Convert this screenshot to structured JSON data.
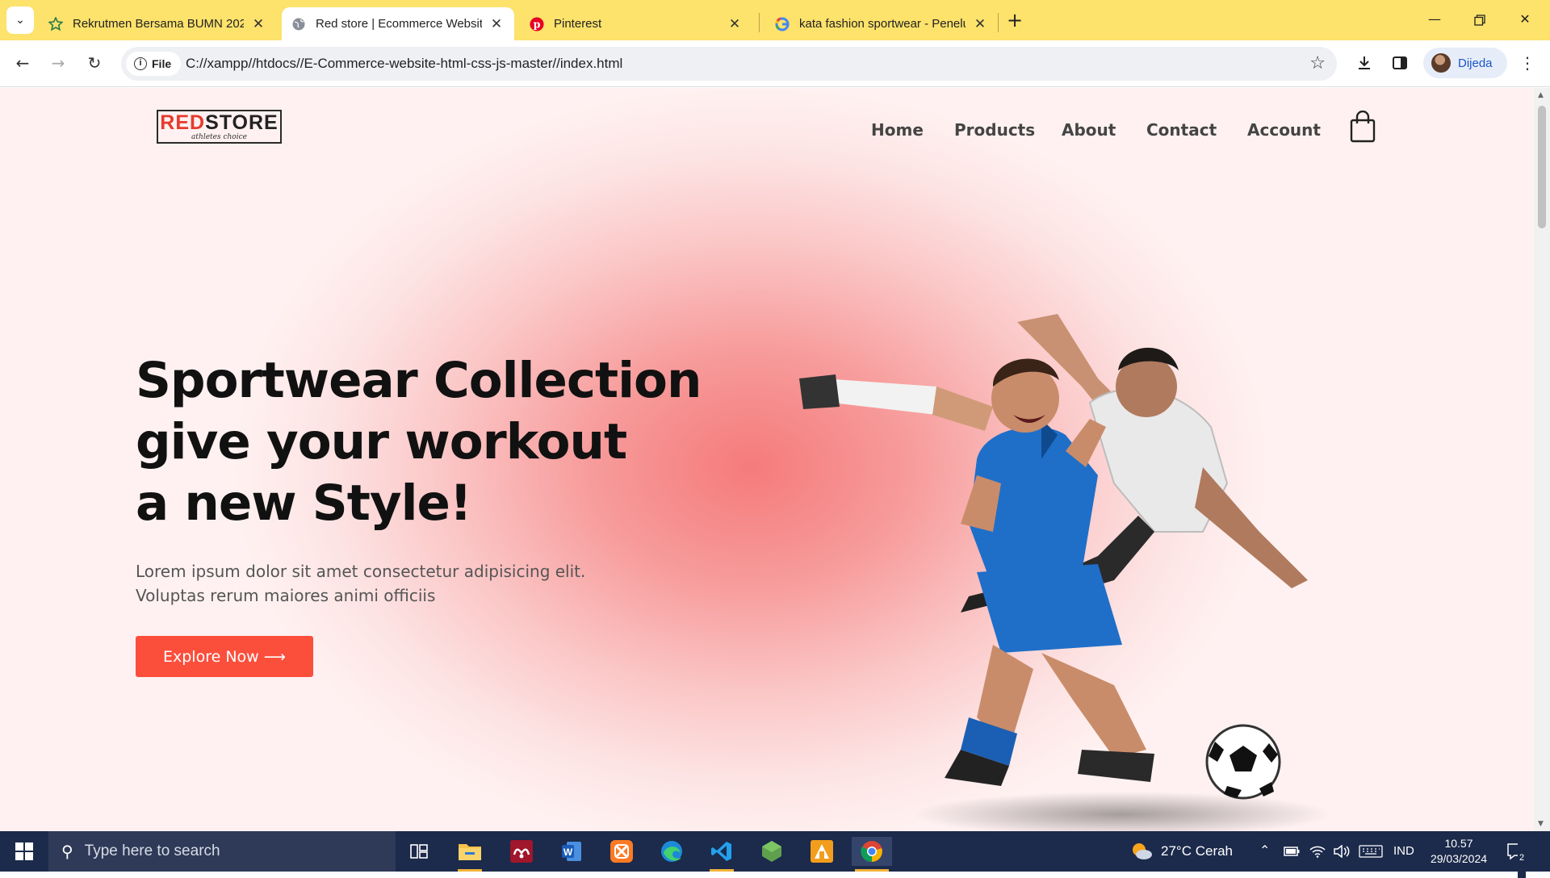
{
  "browser": {
    "tabs": [
      {
        "title": "Rekrutmen Bersama BUMN 202",
        "favicon": "bumn-star-icon",
        "active": false
      },
      {
        "title": "Red store | Ecommerce Website",
        "favicon": "globe-icon",
        "active": true
      },
      {
        "title": "Pinterest",
        "favicon": "pinterest-icon",
        "active": false
      },
      {
        "title": "kata fashion sportwear - Penelu",
        "favicon": "google-icon",
        "active": false
      }
    ],
    "file_chip": "File",
    "url": "C://xampp//htdocs//E-Commerce-website-html-css-js-master//index.html",
    "profile_name": "Dijeda"
  },
  "site": {
    "logo": {
      "red": "RED",
      "dark": "STORE",
      "tagline": "athletes choice"
    },
    "nav": [
      "Home",
      "Products",
      "About",
      "Contact",
      "Account"
    ],
    "hero": {
      "title_lines": [
        "Sportwear Collection",
        "give your workout",
        "a new Style!"
      ],
      "subtitle_lines": [
        "Lorem ipsum dolor sit amet consectetur adipisicing elit.",
        "Voluptas rerum maiores animi officiis"
      ],
      "button": "Explore Now ⟶"
    }
  },
  "taskbar": {
    "search_placeholder": "Type here to search",
    "weather": "27°C  Cerah",
    "language": "IND",
    "time": "10.57",
    "date": "29/03/2024",
    "notifications": "2"
  },
  "colors": {
    "tab_strip": "#fde26b",
    "accent": "#fb4f3c",
    "taskbar": "#1c2a4b"
  }
}
